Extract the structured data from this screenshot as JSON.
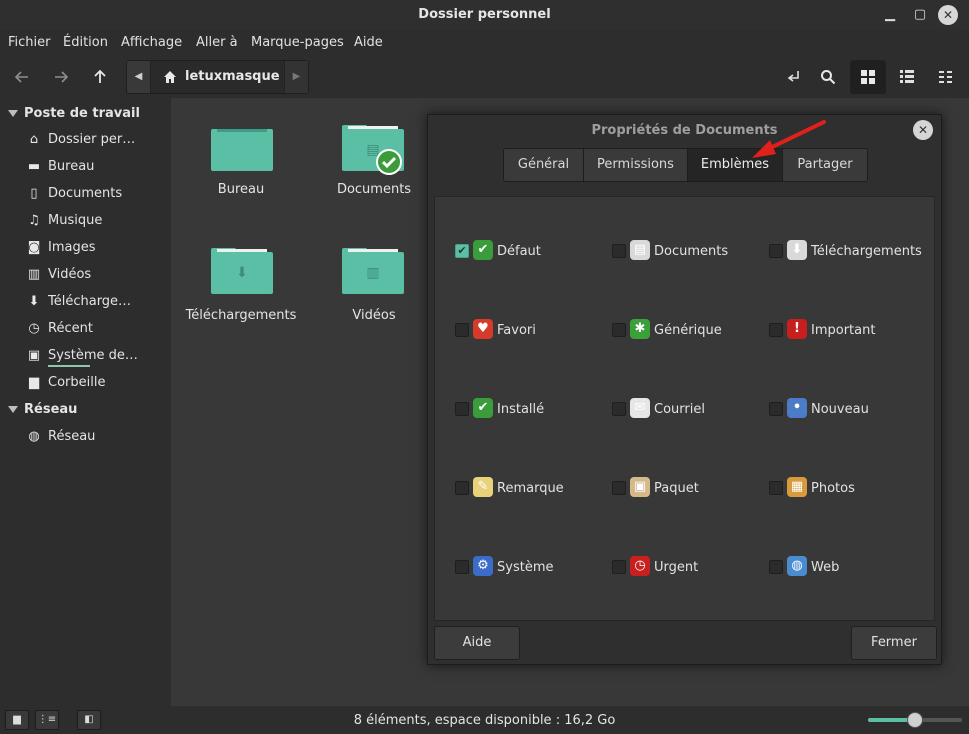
{
  "window": {
    "title": "Dossier personnel"
  },
  "menu": [
    "Fichier",
    "Édition",
    "Affichage",
    "Aller à",
    "Marque-pages",
    "Aide"
  ],
  "path": {
    "current": "letuxmasque"
  },
  "sidebar": {
    "section1": "Poste de travail",
    "items1": [
      {
        "label": "Dossier per…",
        "icon": "home-icon"
      },
      {
        "label": "Bureau",
        "icon": "desktop-icon"
      },
      {
        "label": "Documents",
        "icon": "document-icon"
      },
      {
        "label": "Musique",
        "icon": "music-icon"
      },
      {
        "label": "Images",
        "icon": "camera-icon"
      },
      {
        "label": "Vidéos",
        "icon": "film-icon"
      },
      {
        "label": "Télécharge…",
        "icon": "download-icon"
      },
      {
        "label": "Récent",
        "icon": "history-icon"
      },
      {
        "label": "Système de…",
        "icon": "drive-icon"
      },
      {
        "label": "Corbeille",
        "icon": "trash-icon"
      }
    ],
    "section2": "Réseau",
    "items2": [
      {
        "label": "Réseau",
        "icon": "network-icon"
      }
    ]
  },
  "folders": [
    {
      "label": "Bureau",
      "icon": "desktop-folder-icon"
    },
    {
      "label": "Documents",
      "icon": "documents-folder-icon"
    },
    {
      "label": "Téléchargements",
      "icon": "downloads-folder-icon"
    },
    {
      "label": "Vidéos",
      "icon": "videos-folder-icon"
    }
  ],
  "status": {
    "text": "8 éléments, espace disponible : 16,2 Go",
    "zoom_level": 0.5
  },
  "dialog": {
    "title": "Propriétés de Documents",
    "tabs": [
      "Général",
      "Permissions",
      "Emblèmes",
      "Partager"
    ],
    "selected_tab": "Emblèmes",
    "emblems": [
      {
        "label": "Défaut",
        "checked": true,
        "icon": "check-icon",
        "color": "#3a9c3a",
        "glyph": "✔"
      },
      {
        "label": "Documents",
        "checked": false,
        "icon": "documents-icon",
        "color": "#d9d9d9",
        "glyph": "▤"
      },
      {
        "label": "Téléchargements",
        "checked": false,
        "icon": "download-icon",
        "color": "#d9d9d9",
        "glyph": "⬇"
      },
      {
        "label": "Favori",
        "checked": false,
        "icon": "heart-icon",
        "color": "#d63a2a",
        "glyph": "♥"
      },
      {
        "label": "Générique",
        "checked": false,
        "icon": "generic-icon",
        "color": "#3aa03a",
        "glyph": "✱"
      },
      {
        "label": "Important",
        "checked": false,
        "icon": "important-icon",
        "color": "#c81e1e",
        "glyph": "!"
      },
      {
        "label": "Installé",
        "checked": false,
        "icon": "installed-icon",
        "color": "#3a9c3a",
        "glyph": "✔"
      },
      {
        "label": "Courriel",
        "checked": false,
        "icon": "mail-icon",
        "color": "#e6e6e6",
        "glyph": "✉"
      },
      {
        "label": "Nouveau",
        "checked": false,
        "icon": "new-icon",
        "color": "#4a7cc8",
        "glyph": "•"
      },
      {
        "label": "Remarque",
        "checked": false,
        "icon": "note-icon",
        "color": "#e8d27a",
        "glyph": "✎"
      },
      {
        "label": "Paquet",
        "checked": false,
        "icon": "package-icon",
        "color": "#d6b98a",
        "glyph": "▣"
      },
      {
        "label": "Photos",
        "checked": false,
        "icon": "photos-icon",
        "color": "#d89a3a",
        "glyph": "▦"
      },
      {
        "label": "Système",
        "checked": false,
        "icon": "system-icon",
        "color": "#3a6cc8",
        "glyph": "⚙"
      },
      {
        "label": "Urgent",
        "checked": false,
        "icon": "urgent-icon",
        "color": "#c82020",
        "glyph": "◷"
      },
      {
        "label": "Web",
        "checked": false,
        "icon": "globe-icon",
        "color": "#4a8cd0",
        "glyph": "◍"
      }
    ],
    "help": "Aide",
    "close": "Fermer"
  },
  "colors": {
    "accent": "#5bbfa6",
    "annotation_arrow": "#e0201a"
  }
}
